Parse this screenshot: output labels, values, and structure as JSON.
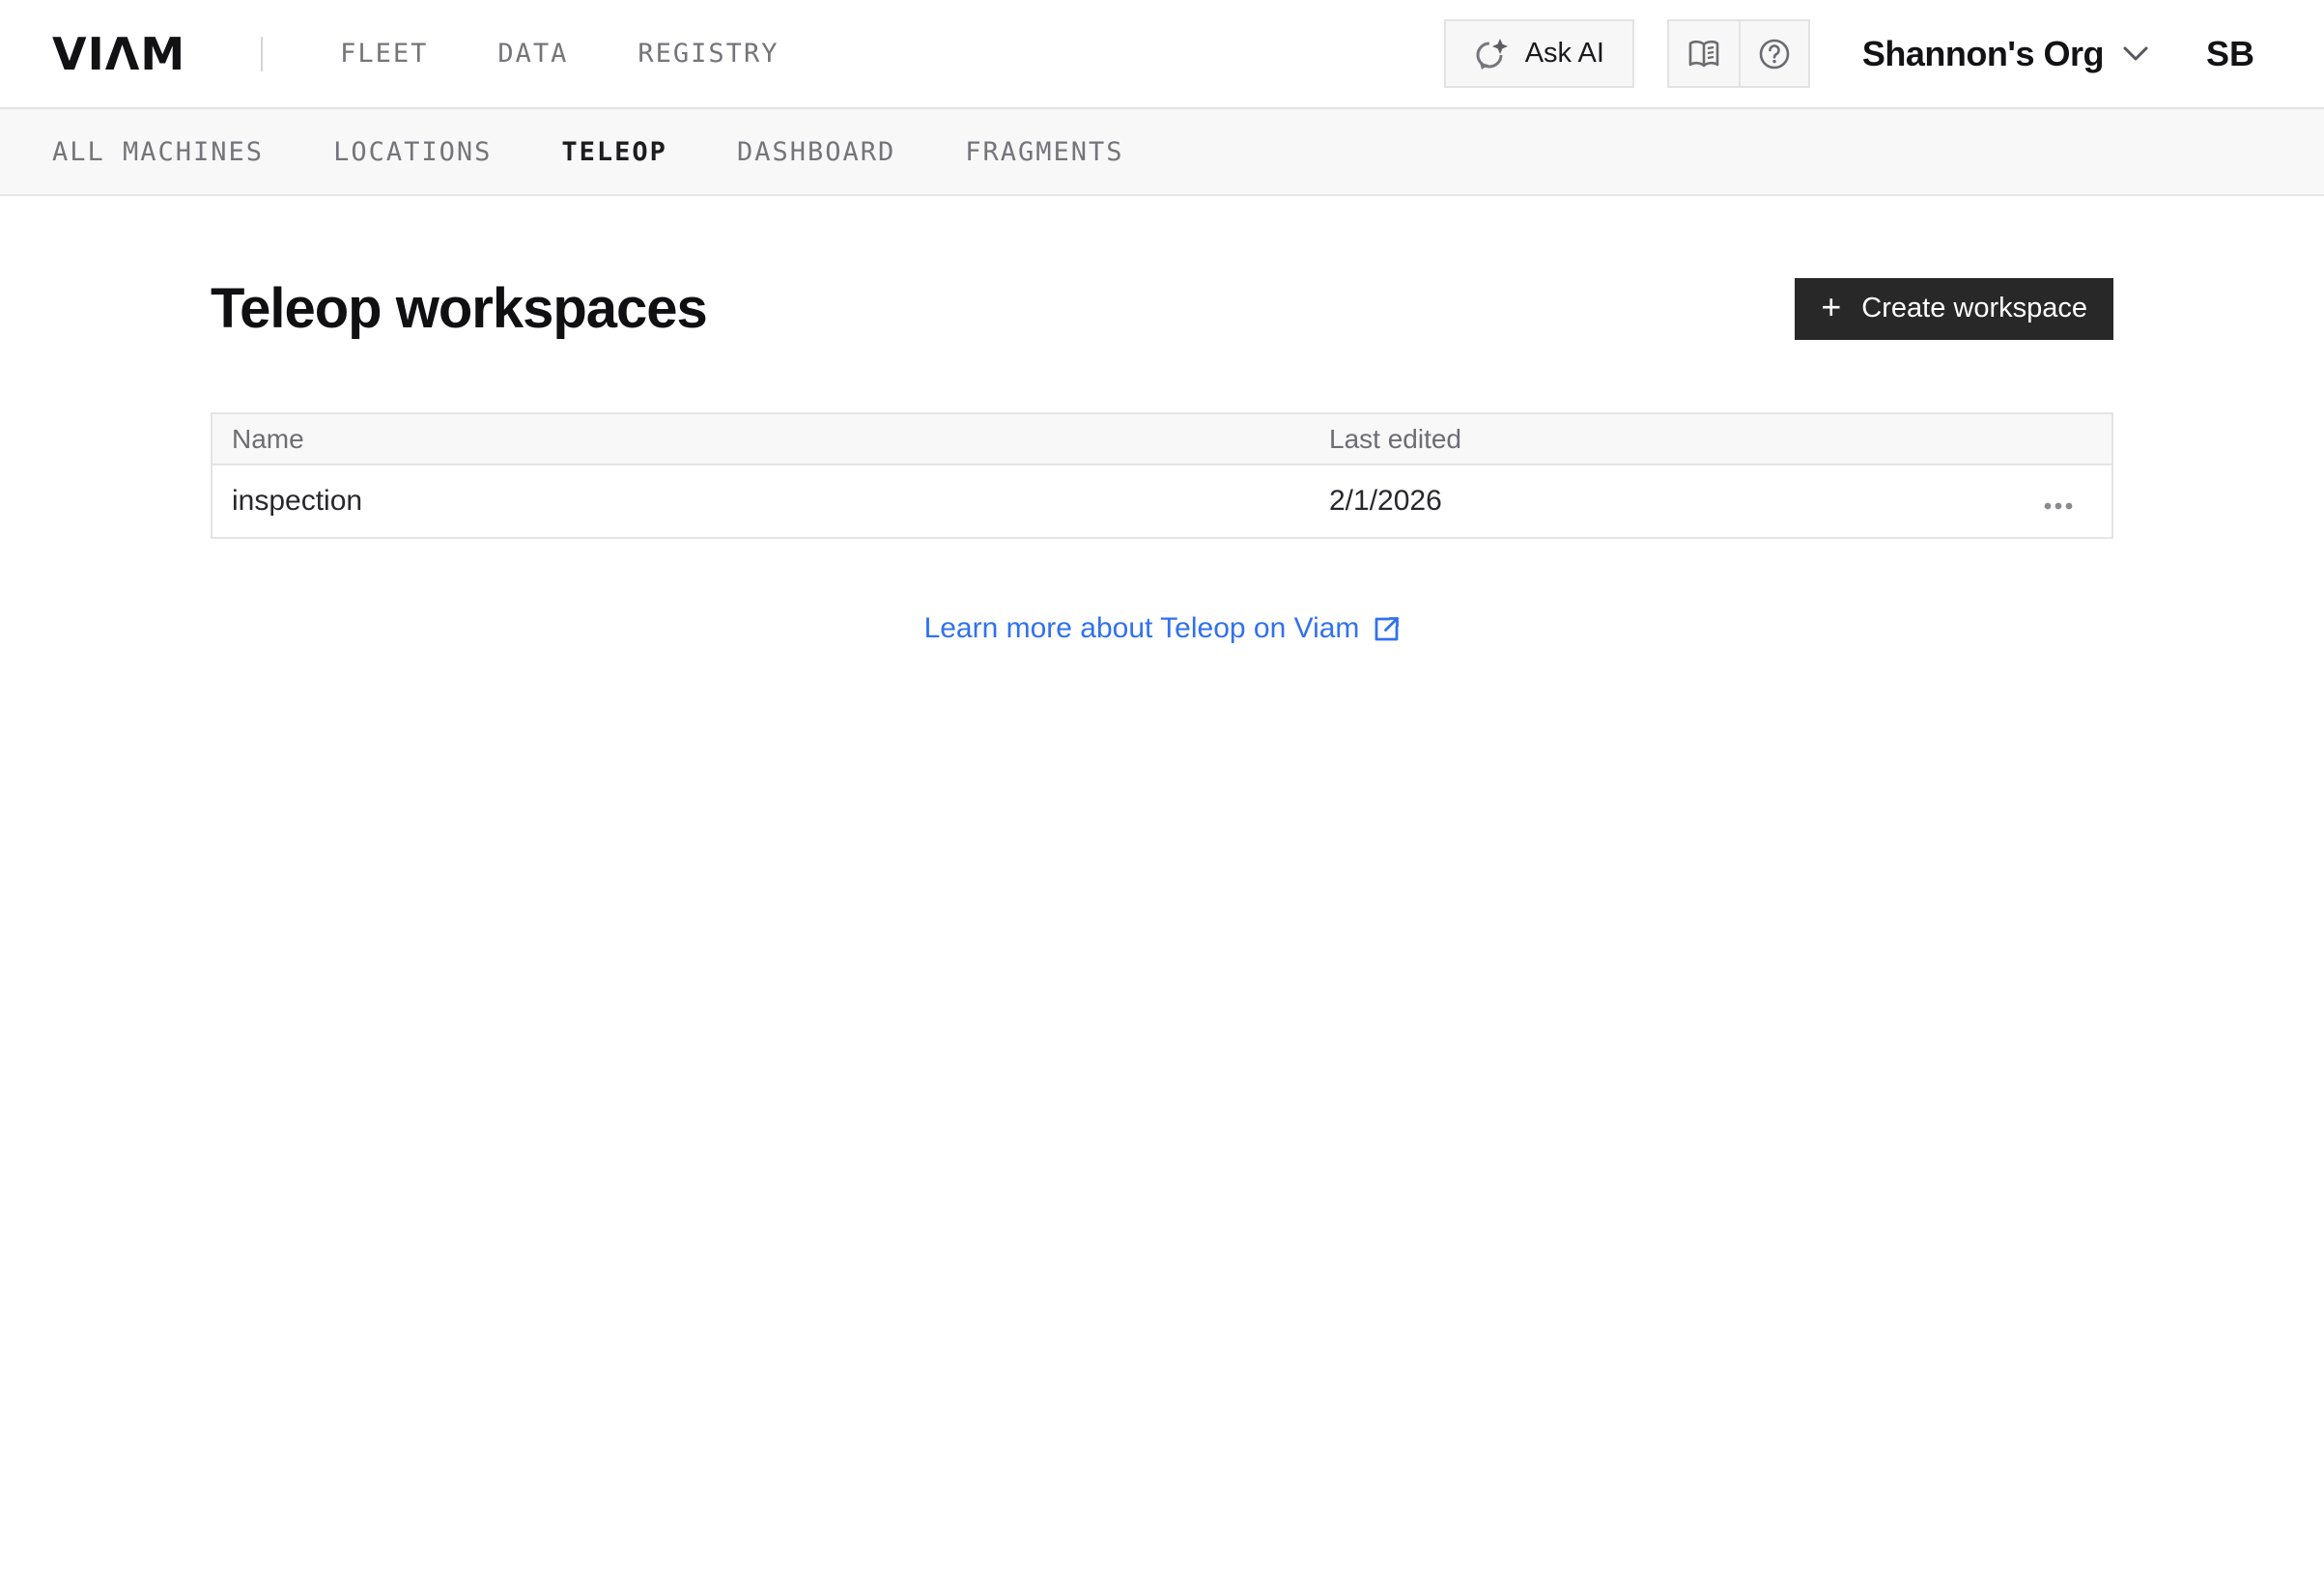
{
  "header": {
    "logo_text": "VIΛM",
    "nav_items": [
      {
        "label": "FLEET"
      },
      {
        "label": "DATA"
      },
      {
        "label": "REGISTRY"
      }
    ],
    "ask_ai": {
      "label": "Ask AI"
    },
    "org_switcher": {
      "label": "Shannon's Org"
    },
    "avatar": {
      "initials": "SB"
    }
  },
  "subnav": {
    "tabs": [
      {
        "label": "ALL MACHINES",
        "active": false
      },
      {
        "label": "LOCATIONS",
        "active": false
      },
      {
        "label": "TELEOP",
        "active": true
      },
      {
        "label": "DASHBOARD",
        "active": false
      },
      {
        "label": "FRAGMENTS",
        "active": false
      }
    ]
  },
  "main": {
    "page_title": "Teleop workspaces",
    "create_workspace": {
      "label": "Create workspace",
      "plus_glyph": "+"
    },
    "table": {
      "columns": [
        {
          "label": "Name"
        },
        {
          "label": "Last edited"
        },
        {
          "label": ""
        }
      ],
      "rows": [
        {
          "name": "inspection",
          "last_edited": "2/1/2026"
        }
      ]
    },
    "learn_more": {
      "label": "Learn more about Teleop on Viam"
    }
  },
  "icons": {
    "ask_ai": "sparkle-refresh-icon",
    "docs": "open-book-icon",
    "help": "question-circle-icon",
    "org_chevron": "chevron-down-icon",
    "plus": "plus-icon",
    "row_more": "more-options-icon",
    "external_link": "external-link-icon"
  },
  "colors": {
    "link_blue": "#3171f0",
    "button_dark": "#282828",
    "nav_gray": "#74747a",
    "subnav_bg": "#f8f8f9",
    "border_gray": "#e4e4e7"
  }
}
